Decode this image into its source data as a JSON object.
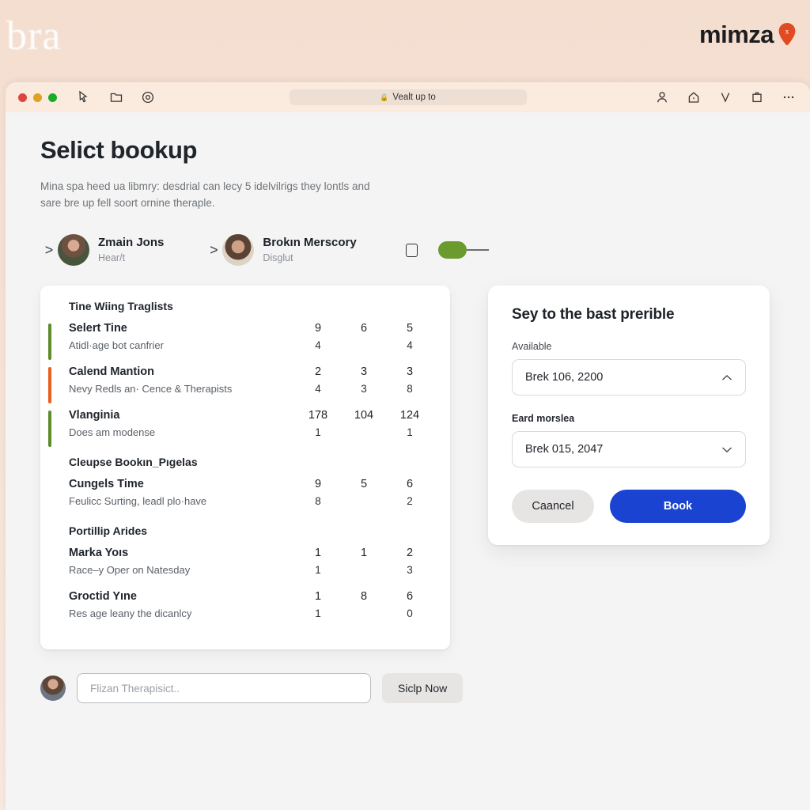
{
  "brand": {
    "left_logo": "bra",
    "right_logo": "mimza",
    "pin_glyph": "x",
    "pin_color": "#e14b21"
  },
  "browser": {
    "lock_icon": "lock-icon",
    "url": "Vealt up to",
    "left_icons": [
      "cursor-select-icon",
      "folder-icon",
      "target-icon"
    ],
    "right_icons": [
      "account-icon",
      "home-icon",
      "download-icon",
      "tabs-icon",
      "more-icon"
    ]
  },
  "page": {
    "title": "Selict bookup",
    "subtitle": "Mina spa heed ua libmry: desdrial can lecy 5 idelvilrigs they lontls and sare bre up fell soort ornine theraple."
  },
  "people": [
    {
      "chevron": ">",
      "name": "Zmain Jons",
      "role": "Hear/t",
      "avatar": "av-a"
    },
    {
      "chevron": ">",
      "name": "Brokın Merscory",
      "role": "Disglut",
      "avatar": "av-b"
    }
  ],
  "people_controls": {
    "checkbox": "checkbox-icon",
    "toggle_color": "#6b9b2f"
  },
  "list": {
    "groups": [
      {
        "heading": "Tine Wiing Traglists",
        "items": [
          {
            "title": "Selert Tine",
            "desc": "Atidl·age bot canfrier",
            "bar_color": "#5f8b2c",
            "title_nums": [
              "9",
              "6",
              "5"
            ],
            "desc_nums": [
              "4",
              "",
              "4"
            ]
          },
          {
            "title": "Calend Mantion",
            "desc": "Nevy Redls an· Cence & Therapists",
            "bar_color": "#e8601f",
            "title_nums": [
              "2",
              "3",
              "3"
            ],
            "desc_nums": [
              "4",
              "3",
              "8"
            ]
          },
          {
            "title": "Vlanginia",
            "desc": "Does am modense",
            "bar_color": "#5f8b2c",
            "title_nums": [
              "178",
              "104",
              "124"
            ],
            "desc_nums": [
              "1",
              "",
              "1"
            ]
          }
        ]
      },
      {
        "heading": "Cleupse Bookın_Pıgelas",
        "items": [
          {
            "title": "Cungels Time",
            "desc": "Feulicc Surting, leadl plo·have",
            "bar_color": "",
            "title_nums": [
              "9",
              "5",
              "6"
            ],
            "desc_nums": [
              "8",
              "",
              "2"
            ]
          }
        ]
      },
      {
        "heading": "Portillip Arides",
        "items": [
          {
            "title": "Marka Yoıs",
            "desc": "Race–y Oper on Natesday",
            "bar_color": "",
            "title_nums": [
              "1",
              "1",
              "2"
            ],
            "desc_nums": [
              "1",
              "",
              "3"
            ]
          },
          {
            "title": "Groctid Yıne",
            "desc": "Res age leany the dicanlcy",
            "bar_color": "",
            "title_nums": [
              "1",
              "8",
              "6"
            ],
            "desc_nums": [
              "1",
              "",
              "0"
            ]
          }
        ]
      }
    ]
  },
  "panel": {
    "title": "Sey to the bast prerible",
    "field1": {
      "label": "Available",
      "value": "Brek 106, 2200",
      "caret": "chevron-up-icon"
    },
    "field2": {
      "label": "Eard morslea",
      "value": "Brek 015, 2047",
      "caret": "chevron-down-icon"
    },
    "cancel_label": "Caancel",
    "book_label": "Book",
    "book_color": "#1a43d1"
  },
  "bottom": {
    "avatar": "av-c",
    "search_placeholder": "Flizan Therapisict..",
    "skip_label": "Siclp Now"
  }
}
